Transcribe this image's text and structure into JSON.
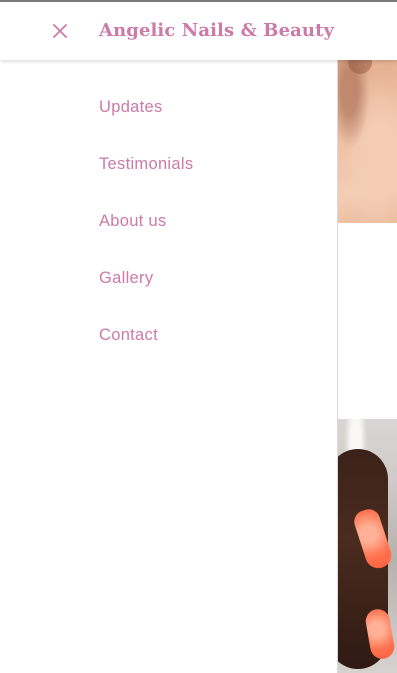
{
  "header": {
    "title": "Angelic Nails & Beauty",
    "close_icon": "close-icon"
  },
  "nav": {
    "items": [
      {
        "label": "Updates"
      },
      {
        "label": "Testimonials"
      },
      {
        "label": "About us"
      },
      {
        "label": "Gallery"
      },
      {
        "label": "Contact"
      }
    ]
  },
  "colors": {
    "accent": "#cc7aa8",
    "background": "#ffffff"
  }
}
